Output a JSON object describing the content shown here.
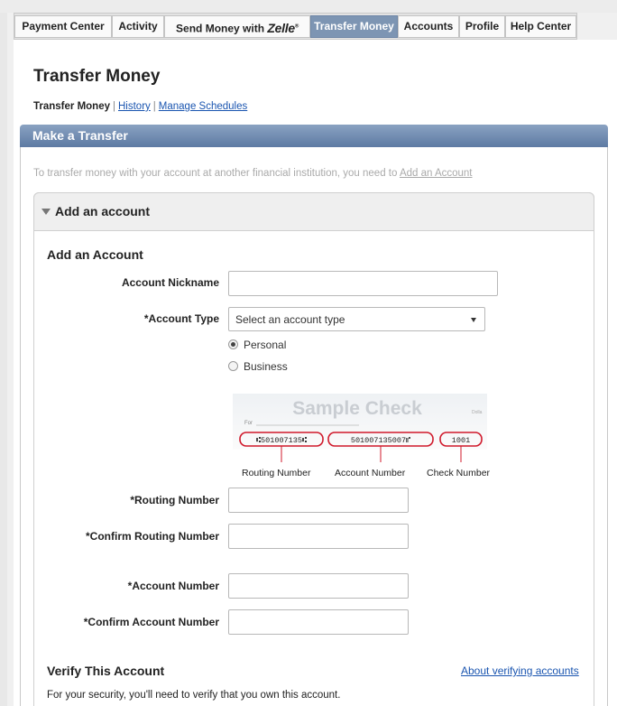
{
  "nav": {
    "tabs": [
      {
        "label": "Payment Center"
      },
      {
        "label": "Activity"
      },
      {
        "label": "Send Money with",
        "brand": "Zelle"
      },
      {
        "label": "Transfer Money",
        "active": true
      },
      {
        "label": "Accounts"
      },
      {
        "label": "Profile"
      },
      {
        "label": "Help Center"
      }
    ]
  },
  "page": {
    "title": "Transfer Money",
    "subnav": {
      "current": "Transfer Money",
      "history": "History",
      "manage": "Manage Schedules"
    }
  },
  "transfer": {
    "header": "Make a Transfer",
    "info_text": "To transfer money with your account at another financial institution, you need to ",
    "info_link": "Add an Account"
  },
  "accordion": {
    "title": "Add an account",
    "arrow_icon": "triangle-down-icon"
  },
  "form": {
    "section_title": "Add an Account",
    "nickname_label": "Account Nickname",
    "nickname_value": "",
    "account_type_label": "*Account Type",
    "account_type_selected": "Select an account type",
    "radio_personal": "Personal",
    "radio_business": "Business",
    "radio_selected": "Personal",
    "check": {
      "title": "Sample Check",
      "for_label": "For",
      "dollars_label": "Dolla",
      "routing_digits": "⑆501007135⑆",
      "account_digits": "501007135007⑈",
      "check_digits": "1001",
      "routing_caption": "Routing Number",
      "account_caption": "Account Number",
      "check_caption": "Check Number",
      "highlight_color": "#d0192b"
    },
    "routing_label": "*Routing Number",
    "confirm_routing_label": "*Confirm Routing Number",
    "account_number_label": "*Account Number",
    "confirm_account_label": "*Confirm Account Number"
  },
  "verify": {
    "title": "Verify This Account",
    "link": "About verifying accounts",
    "text": "For your security, you'll need to verify that you own this account."
  },
  "colors": {
    "active_tab": "#7d95b3",
    "header_gradient_top": "#8aa2c2",
    "header_gradient_bottom": "#5d7aa3",
    "link": "#1a55b0"
  }
}
